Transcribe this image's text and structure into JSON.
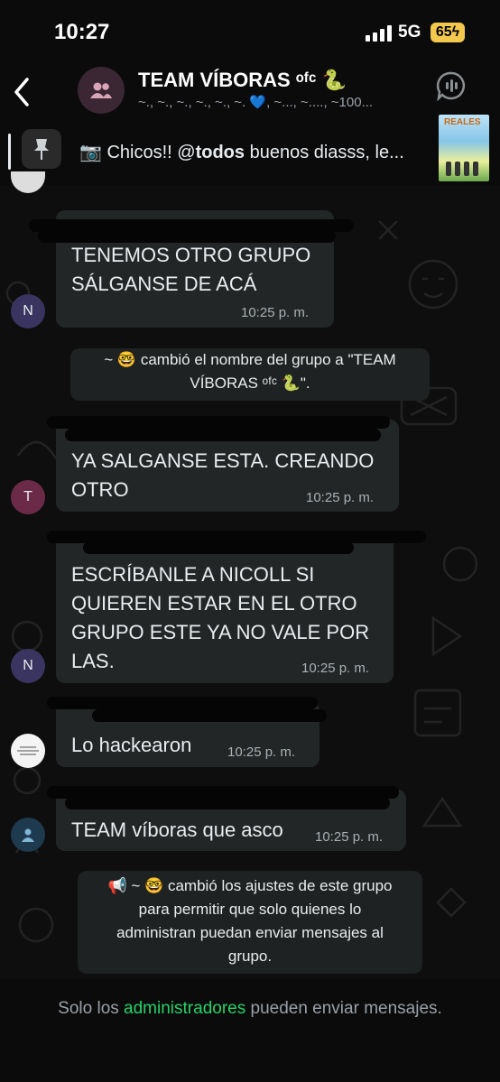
{
  "status_bar": {
    "time": "10:27",
    "network": "5G",
    "battery": "65"
  },
  "header": {
    "title": "TEAM VÍBORAS ᵒᶠᶜ 🐍",
    "subtitle": "~., ~., ~., ~., ~., ~. 💙, ~..., ~...., ~100..."
  },
  "pinned": {
    "text_prefix": "Chicos!! @",
    "mention": "todos",
    "text_rest": " buenos diasss, le...",
    "thumb_text": "REALES"
  },
  "messages": [
    {
      "avatar_letter": "",
      "lines": [
        "TENEMOS OTRO GRUPO",
        "SÁLGANSE DE ACÁ"
      ],
      "time": "10:25 p. m."
    },
    {
      "avatar_letter": "N"
    },
    {
      "avatar_letter": "T",
      "lines": [
        "YA SALGANSE ESTA. CREANDO",
        "OTRO"
      ],
      "time": "10:25 p. m."
    },
    {
      "avatar_letter": "N",
      "lines": [
        "ESCRÍBANLE A NICOLL SI",
        "QUIEREN ESTAR EN EL OTRO",
        "GRUPO ESTE YA NO VALE POR",
        "LAS."
      ],
      "time": "10:25 p. m."
    },
    {
      "lines": [
        "Lo hackearon"
      ],
      "time": "10:25 p. m."
    },
    {
      "lines": [
        "TEAM víboras que asco"
      ],
      "time": "10:25 p. m."
    }
  ],
  "system_messages": [
    {
      "lines": [
        "~ 🤓 cambió el nombre del grupo a \"TEAM",
        "VÍBORAS ᵒᶠᶜ 🐍\"."
      ]
    },
    {
      "lines": [
        "📢 ~ 🤓 cambió los ajustes de este grupo",
        "para permitir que solo quienes lo",
        "administran puedan enviar mensajes al",
        "grupo."
      ]
    }
  ],
  "footer": {
    "prefix": "Solo los ",
    "highlight": "administradores",
    "suffix": " pueden enviar mensajes."
  },
  "colors": {
    "accent": "#25d366",
    "bubble": "#232627",
    "background": "#0e0e0e"
  }
}
